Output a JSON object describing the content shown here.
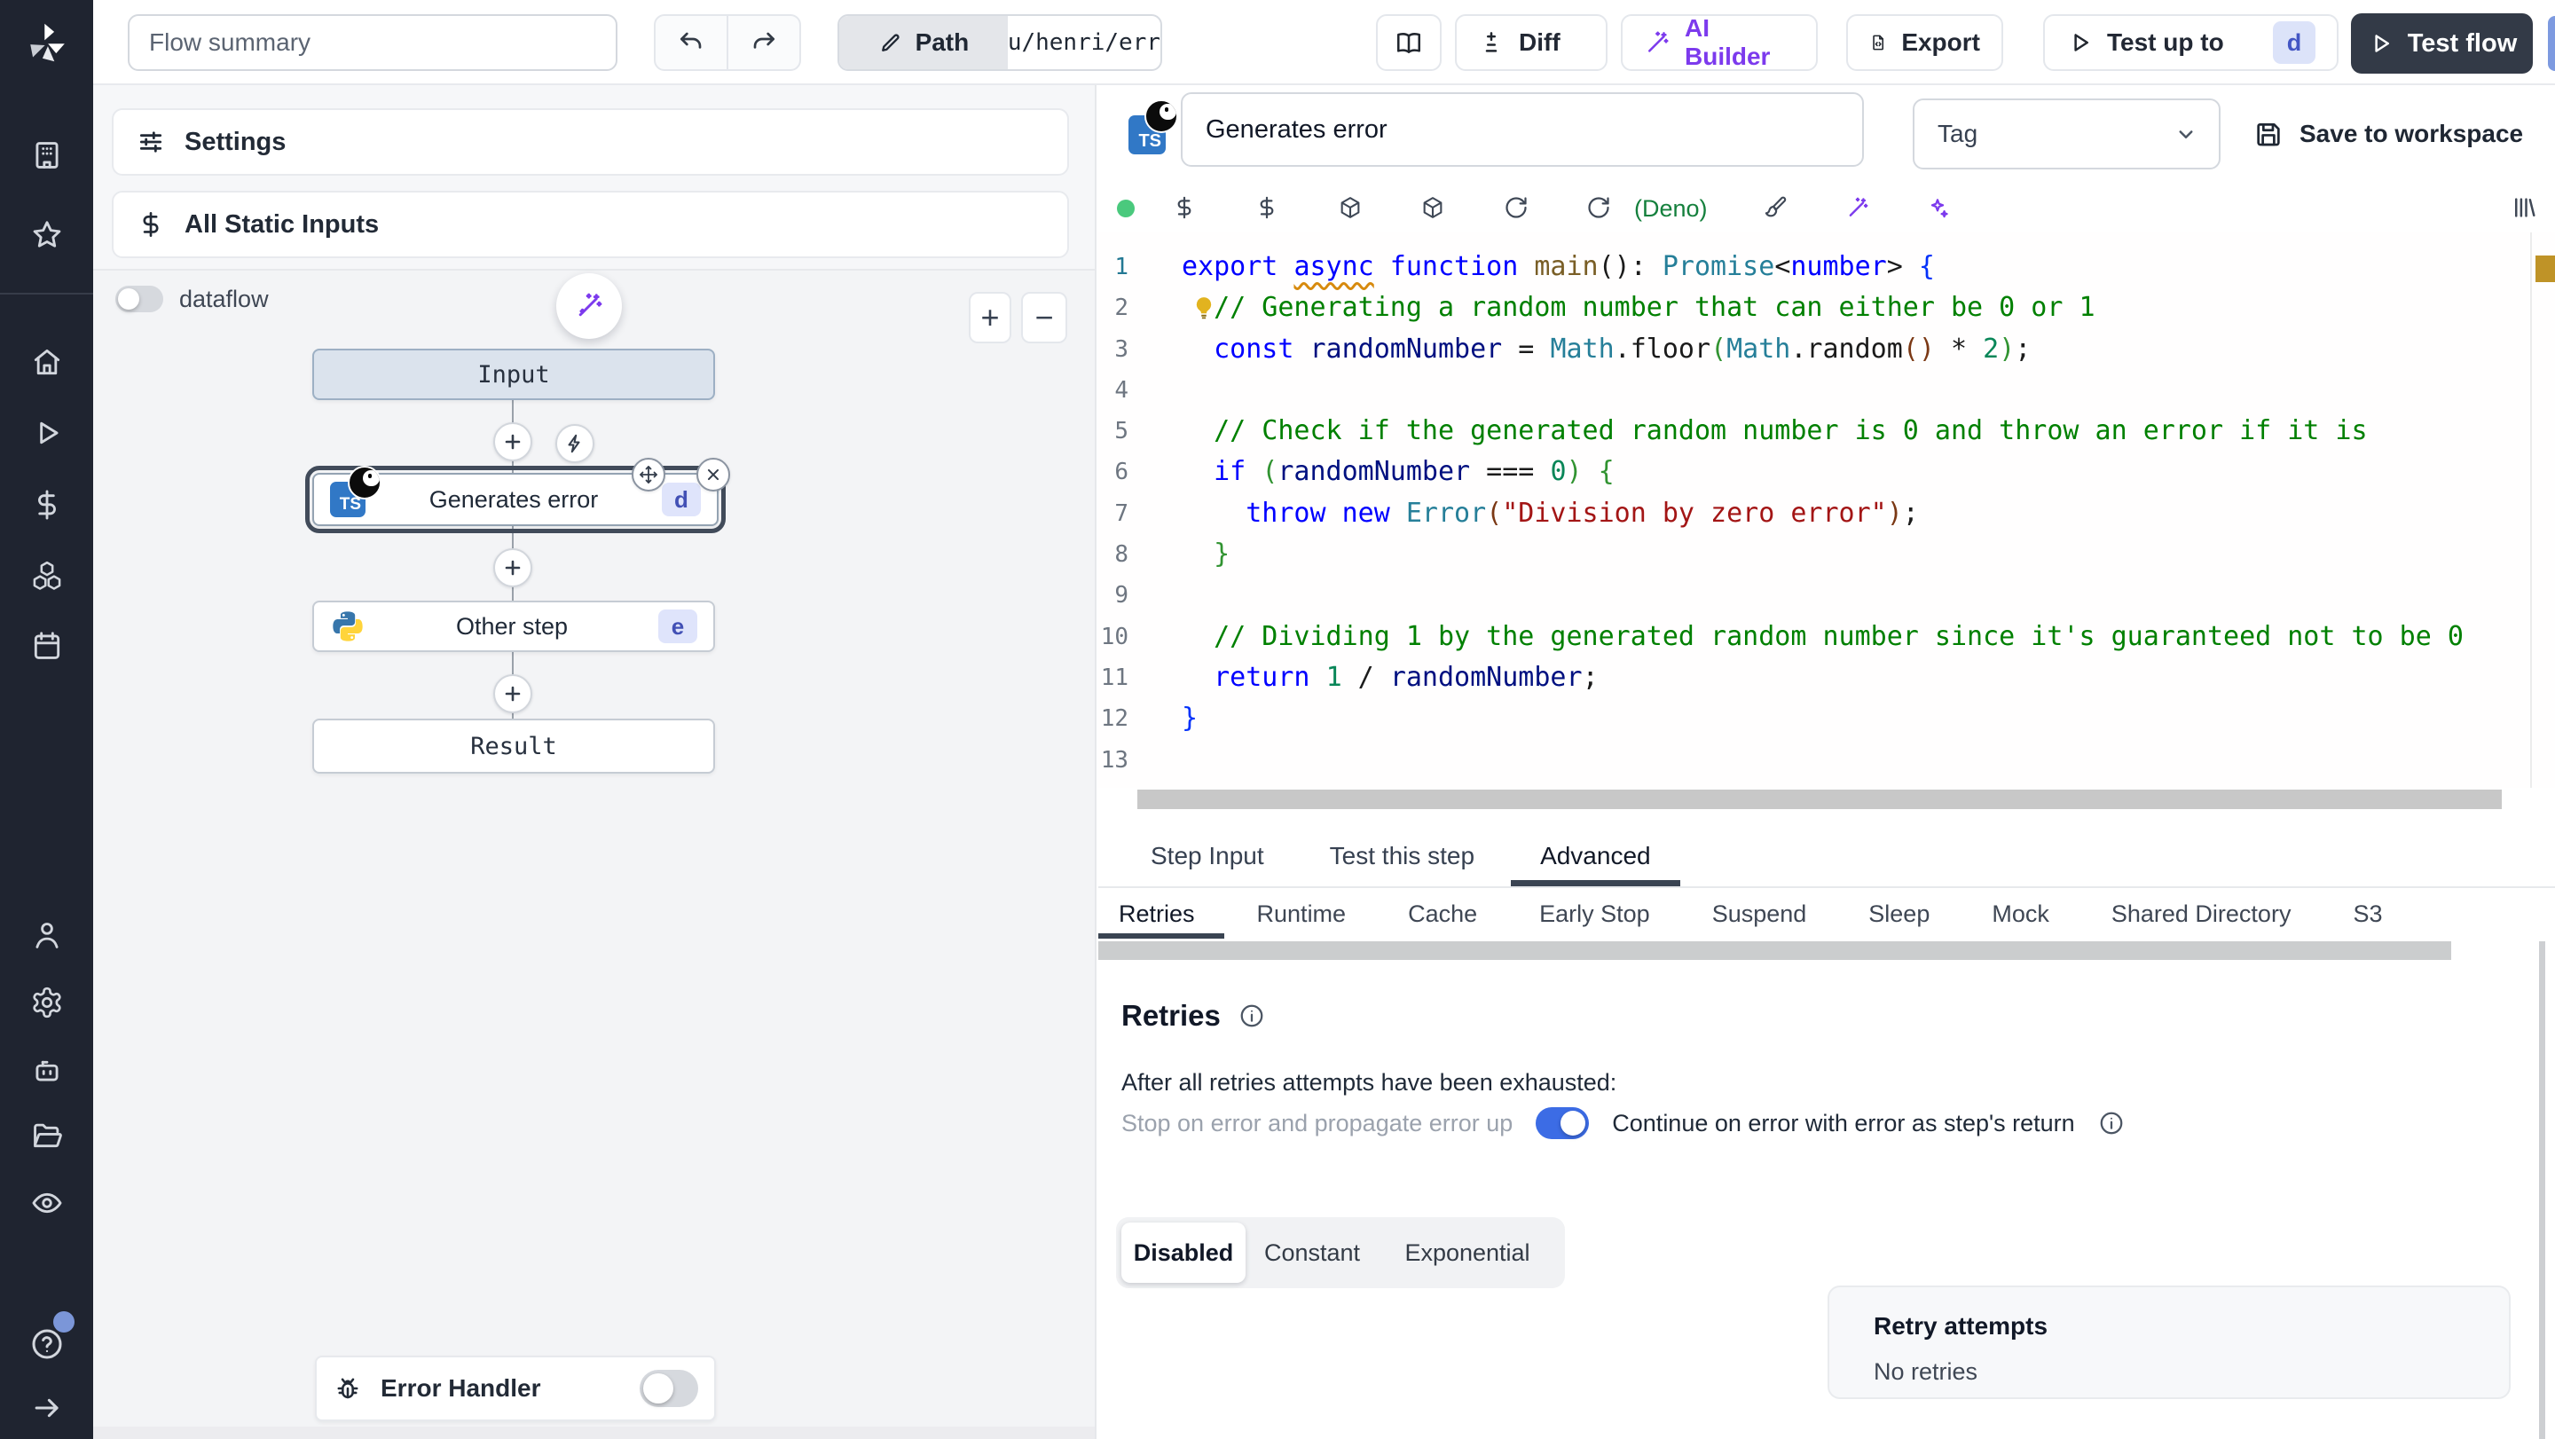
{
  "topbar": {
    "flow_summary_placeholder": "Flow summary",
    "path_label": "Path",
    "path_value": "u/henri/err",
    "diff_label": "Diff",
    "ai_builder_label": "AI Builder",
    "export_label": "Export",
    "test_up_to_label": "Test up to",
    "test_up_to_badge": "d",
    "test_flow_label": "Test flow"
  },
  "sidebar": {
    "icons": [
      "building-icon",
      "star-icon",
      "home-icon",
      "play-icon",
      "dollar-icon",
      "boxes-icon",
      "calendar-icon",
      "user-icon",
      "gear-icon",
      "robot-icon",
      "folder-icon",
      "eye-icon",
      "help-icon",
      "expand-arrow-icon"
    ]
  },
  "flow_panel": {
    "settings_label": "Settings",
    "static_inputs_label": "All Static Inputs",
    "dataflow_label": "dataflow",
    "error_handler_label": "Error Handler",
    "graph": {
      "input_label": "Input",
      "result_label": "Result",
      "steps": [
        {
          "label": "Generates error",
          "badge": "d",
          "lang": "typescript-deno",
          "selected": true
        },
        {
          "label": "Other step",
          "badge": "e",
          "lang": "python",
          "selected": false
        }
      ]
    }
  },
  "editor": {
    "step_name": "Generates error",
    "tag_placeholder": "Tag",
    "save_label": "Save to workspace",
    "runtime_label": "(Deno)",
    "code": {
      "language": "typescript",
      "lines": [
        [
          [
            "kw",
            "export "
          ],
          [
            "kww",
            "async"
          ],
          [
            "kw",
            " function "
          ],
          [
            "fn",
            "main"
          ],
          [
            "pl",
            "(): "
          ],
          [
            "ty",
            "Promise"
          ],
          [
            "pl",
            "<"
          ],
          [
            "kw",
            "number"
          ],
          [
            "pl",
            "> "
          ],
          [
            "b1",
            "{"
          ]
        ],
        [
          [
            "pl",
            "  "
          ],
          [
            "com",
            "// Generating a random number that can either be 0 or 1"
          ]
        ],
        [
          [
            "pl",
            "  "
          ],
          [
            "kw",
            "const"
          ],
          [
            "pl",
            " "
          ],
          [
            "vr",
            "randomNumber"
          ],
          [
            "pl",
            " = "
          ],
          [
            "ty",
            "Math"
          ],
          [
            "pl",
            ".floor"
          ],
          [
            "b2",
            "("
          ],
          [
            "ty",
            "Math"
          ],
          [
            "pl",
            ".random"
          ],
          [
            "b3",
            "()"
          ],
          [
            "pl",
            " * "
          ],
          [
            "num",
            "2"
          ],
          [
            "b2",
            ")"
          ],
          [
            "pl",
            ";"
          ]
        ],
        [],
        [
          [
            "pl",
            "  "
          ],
          [
            "com",
            "// Check if the generated random number is 0 and throw an error if it is"
          ]
        ],
        [
          [
            "pl",
            "  "
          ],
          [
            "kw",
            "if"
          ],
          [
            "pl",
            " "
          ],
          [
            "b2",
            "("
          ],
          [
            "vr",
            "randomNumber"
          ],
          [
            "pl",
            " === "
          ],
          [
            "num",
            "0"
          ],
          [
            "b2",
            ")"
          ],
          [
            "pl",
            " "
          ],
          [
            "b2",
            "{"
          ]
        ],
        [
          [
            "pl",
            "    "
          ],
          [
            "kw",
            "throw"
          ],
          [
            "pl",
            " "
          ],
          [
            "kw",
            "new"
          ],
          [
            "pl",
            " "
          ],
          [
            "ty",
            "Error"
          ],
          [
            "b3",
            "("
          ],
          [
            "str",
            "\"Division by zero error\""
          ],
          [
            "b3",
            ")"
          ],
          [
            "pl",
            ";"
          ]
        ],
        [
          [
            "pl",
            "  "
          ],
          [
            "b2",
            "}"
          ]
        ],
        [],
        [
          [
            "pl",
            "  "
          ],
          [
            "com",
            "// Dividing 1 by the generated random number since it's guaranteed not to be 0"
          ]
        ],
        [
          [
            "pl",
            "  "
          ],
          [
            "kw",
            "return"
          ],
          [
            "pl",
            " "
          ],
          [
            "num",
            "1"
          ],
          [
            "pl",
            " / "
          ],
          [
            "vr",
            "randomNumber"
          ],
          [
            "pl",
            ";"
          ]
        ],
        [
          [
            "b1",
            "}"
          ]
        ],
        []
      ]
    }
  },
  "bottom": {
    "tabs": [
      {
        "label": "Step Input"
      },
      {
        "label": "Test this step"
      },
      {
        "label": "Advanced"
      }
    ],
    "active_tab": "Advanced",
    "subtabs": [
      {
        "label": "Retries"
      },
      {
        "label": "Runtime"
      },
      {
        "label": "Cache"
      },
      {
        "label": "Early Stop"
      },
      {
        "label": "Suspend"
      },
      {
        "label": "Sleep"
      },
      {
        "label": "Mock"
      },
      {
        "label": "Shared Directory"
      },
      {
        "label": "S3"
      }
    ],
    "active_subtab": "Retries",
    "retries": {
      "heading": "Retries",
      "exhausted_label": "After all retries attempts have been exhausted:",
      "stop_option": "Stop on error and propagate error up",
      "continue_option": "Continue on error with error as step's return",
      "continue_enabled": true,
      "modes": [
        {
          "label": "Disabled"
        },
        {
          "label": "Constant"
        },
        {
          "label": "Exponential"
        }
      ],
      "active_mode": "Disabled",
      "retry_attempts_label": "Retry attempts",
      "retry_attempts_value": "No retries"
    }
  },
  "colors": {
    "accent_purple": "#7c3aed",
    "deno_green": "#15803d",
    "toggle_on_blue": "#3c6ce5",
    "badge_indigo_bg": "#dfe4fb",
    "badge_indigo_text": "#4250b5",
    "ts_blue": "#3178c6",
    "test_flow_dark": "#333a47",
    "status_dot_green": "#4ac97d",
    "warning_gold": "#bf9327"
  }
}
